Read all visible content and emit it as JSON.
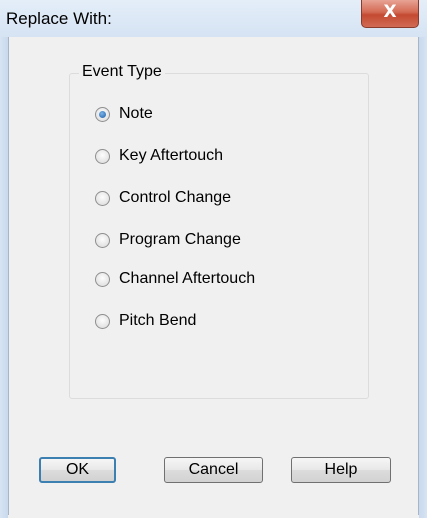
{
  "window": {
    "title": "Replace With:",
    "close_glyph": "X",
    "colors": {
      "close_button": "#c44a32",
      "titlebar": "#dbe8f6",
      "client": "#f0f0f0"
    }
  },
  "event_type": {
    "label": "Event Type",
    "options": [
      {
        "label": "Note",
        "selected": true
      },
      {
        "label": "Key Aftertouch",
        "selected": false
      },
      {
        "label": "Control Change",
        "selected": false
      },
      {
        "label": "Program Change",
        "selected": false
      },
      {
        "label": "Channel Aftertouch",
        "selected": false
      },
      {
        "label": "Pitch Bend",
        "selected": false
      }
    ]
  },
  "buttons": {
    "ok": "OK",
    "cancel": "Cancel",
    "help": "Help"
  }
}
